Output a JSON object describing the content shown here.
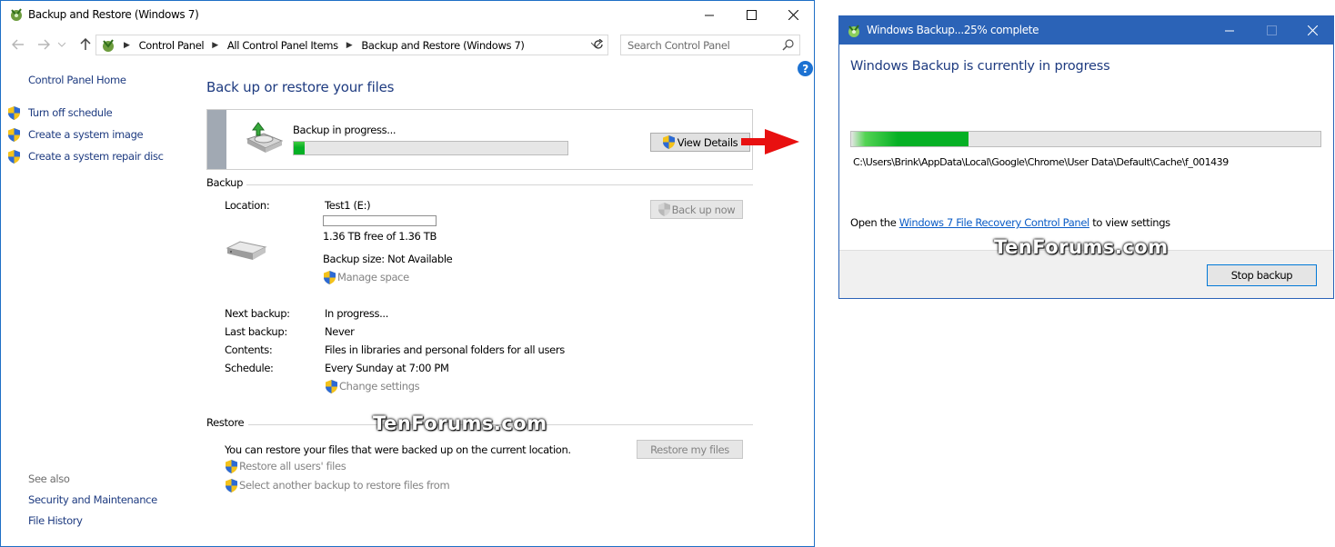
{
  "main_window": {
    "title": "Backup and Restore (Windows 7)",
    "breadcrumbs": [
      "Control Panel",
      "All Control Panel Items",
      "Backup and Restore (Windows 7)"
    ],
    "search_placeholder": "Search Control Panel",
    "left_nav": {
      "home": "Control Panel Home",
      "items": [
        "Turn off schedule",
        "Create a system image",
        "Create a system repair disc"
      ],
      "see_also_label": "See also",
      "see_also": [
        "Security and Maintenance",
        "File History"
      ]
    },
    "heading": "Back up or restore your files",
    "progress": {
      "status": "Backup in progress...",
      "percent": 4,
      "view_details_label": "View Details"
    },
    "backup": {
      "section_label": "Backup",
      "location_label": "Location:",
      "location_value": "Test1 (E:)",
      "drive_used_fraction": 0.0,
      "free_space": "1.36 TB free of 1.36 TB",
      "backup_size": "Backup size: Not Available",
      "manage_space": "Manage space",
      "back_up_now": "Back up now",
      "next_backup_label": "Next backup:",
      "next_backup_value": "In progress...",
      "last_backup_label": "Last backup:",
      "last_backup_value": "Never",
      "contents_label": "Contents:",
      "contents_value": "Files in libraries and personal folders for all users",
      "schedule_label": "Schedule:",
      "schedule_value": "Every Sunday at 7:00 PM",
      "change_settings": "Change settings"
    },
    "restore": {
      "section_label": "Restore",
      "description": "You can restore your files that were backed up on the current location.",
      "restore_my_files": "Restore my files",
      "restore_all_users": "Restore all users' files",
      "select_another": "Select another backup to restore files from"
    }
  },
  "dialog": {
    "title": "Windows Backup...25% complete",
    "heading": "Windows Backup is currently in progress",
    "percent": 25,
    "current_file": "C:\\Users\\Brink\\AppData\\Local\\Google\\Chrome\\User Data\\Default\\Cache\\f_001439",
    "open_prefix": "Open the",
    "open_link": "Windows 7 File Recovery Control Panel",
    "open_suffix": "to view settings",
    "stop_button": "Stop backup"
  },
  "watermarks": [
    "TenForums.com",
    "TenForums.com"
  ],
  "colors": {
    "accent": "#2b63b7",
    "link": "#1e3b80",
    "progress_green": "#06b025",
    "arrow_red": "#e81010"
  }
}
